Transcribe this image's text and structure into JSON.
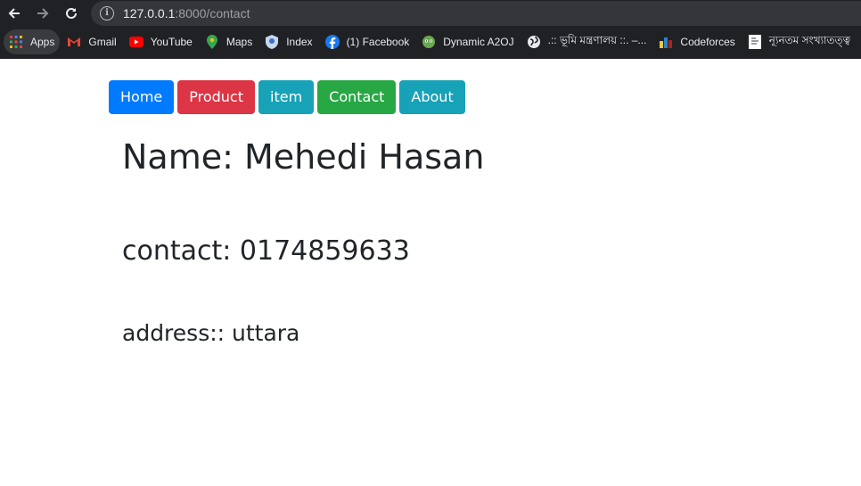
{
  "browser": {
    "url_host": "127.0.0.1",
    "url_rest": ":8000/contact",
    "bookmarks": [
      {
        "label": "Apps",
        "icon": "apps-grid-icon"
      },
      {
        "label": "Gmail",
        "icon": "gmail-icon"
      },
      {
        "label": "YouTube",
        "icon": "youtube-icon"
      },
      {
        "label": "Maps",
        "icon": "maps-pin-icon"
      },
      {
        "label": "Index",
        "icon": "index-shield-icon"
      },
      {
        "label": "(1) Facebook",
        "icon": "facebook-icon"
      },
      {
        "label": "Dynamic A2OJ",
        "icon": "a2oj-icon"
      },
      {
        "label": ".:: ভূমি মন্ত্রণালয় ::. –...",
        "icon": "globe-icon"
      },
      {
        "label": "Codeforces",
        "icon": "codeforces-icon"
      },
      {
        "label": "ন্যূনতম সংখ্যাতত্ত্ব",
        "icon": "doc-icon"
      }
    ]
  },
  "nav": {
    "items": [
      {
        "label": "Home",
        "color": "#007bff"
      },
      {
        "label": "Product",
        "color": "#dc3545"
      },
      {
        "label": "item",
        "color": "#17a2b8"
      },
      {
        "label": "Contact",
        "color": "#28a745"
      },
      {
        "label": "About",
        "color": "#17a2b8"
      }
    ]
  },
  "content": {
    "name": "Name: Mehedi Hasan",
    "contact": "contact: 0174859633",
    "address": "address:: uttara"
  }
}
